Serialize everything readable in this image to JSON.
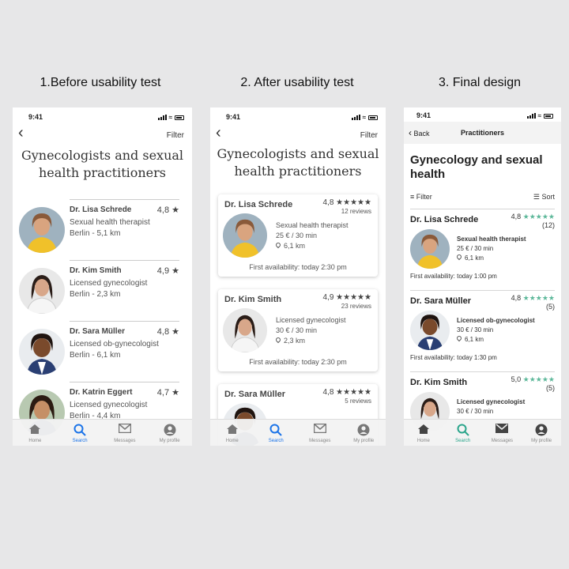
{
  "captions": [
    "1.Before usability test",
    "2. After usability test",
    "3. Final design"
  ],
  "status_time": "9:41",
  "colors": {
    "accent": "#1a73e8",
    "star_green": "#5db89a"
  },
  "phone1": {
    "filter": "Filter",
    "title": "Gynecologists and sexual health practitioners",
    "doctors": [
      {
        "name": "Dr. Lisa Schrede",
        "rating": "4,8 ★",
        "line1": "Sexual health therapist",
        "line2": "Berlin - 5,1 km"
      },
      {
        "name": "Dr. Kim Smith",
        "rating": "4,9 ★",
        "line1": "Licensed gynecologist",
        "line2": "Berlin - 2,3 km"
      },
      {
        "name": "Dr. Sara Müller",
        "rating": "4,8 ★",
        "line1": "Licensed ob-gynecologist",
        "line2": "Berlin - 6,1 km"
      },
      {
        "name": "Dr. Katrin Eggert",
        "rating": "4,7 ★",
        "line1": "Licensed gynecologist",
        "line2": "Berlin - 4,4 km"
      }
    ]
  },
  "phone2": {
    "filter": "Filter",
    "title": "Gynecologists and sexual health practitioners",
    "doctors": [
      {
        "name": "Dr. Lisa Schrede",
        "rating": "4,8 ★★★★★",
        "reviews": "12 reviews",
        "specialty": "Sexual health therapist",
        "price": "25 € / 30 min",
        "distance": "6,1 km",
        "availability": "First availability: today 2:30 pm"
      },
      {
        "name": "Dr. Kim Smith",
        "rating": "4,9 ★★★★★",
        "reviews": "23 reviews",
        "specialty": "Licensed gynecologist",
        "price": "30 € / 30 min",
        "distance": "2,3 km",
        "availability": "First availability: today 2:30 pm"
      },
      {
        "name": "Dr. Sara Müller",
        "rating": "4,8 ★★★★★",
        "reviews": "5 reviews"
      }
    ]
  },
  "phone3": {
    "back": "Back",
    "nav_title": "Practitioners",
    "title": "Gynecology and sexual health",
    "filter": "Filter",
    "sort": "Sort",
    "doctors": [
      {
        "name": "Dr. Lisa Schrede",
        "rating": "4,8",
        "stars": "★★★★★",
        "reviews": "(12)",
        "specialty": "Sexual health therapist",
        "price": "25 € / 30 min",
        "distance": "6,1 km",
        "availability": "First availability: today 1:00 pm"
      },
      {
        "name": "Dr. Sara Müller",
        "rating": "4,8",
        "stars": "★★★★★",
        "reviews": "(5)",
        "specialty": "Licensed ob-gynecologist",
        "price": "30 € / 30 min",
        "distance": "6,1 km",
        "availability": "First availability: today 1:30 pm"
      },
      {
        "name": "Dr. Kim Smith",
        "rating": "5,0",
        "stars": "★★★★★",
        "reviews": "(5)",
        "specialty": "Licensed gynecologist",
        "price": "30 € / 30 min"
      }
    ]
  },
  "tabs": [
    "Home",
    "Search",
    "Messages",
    "My profile"
  ]
}
